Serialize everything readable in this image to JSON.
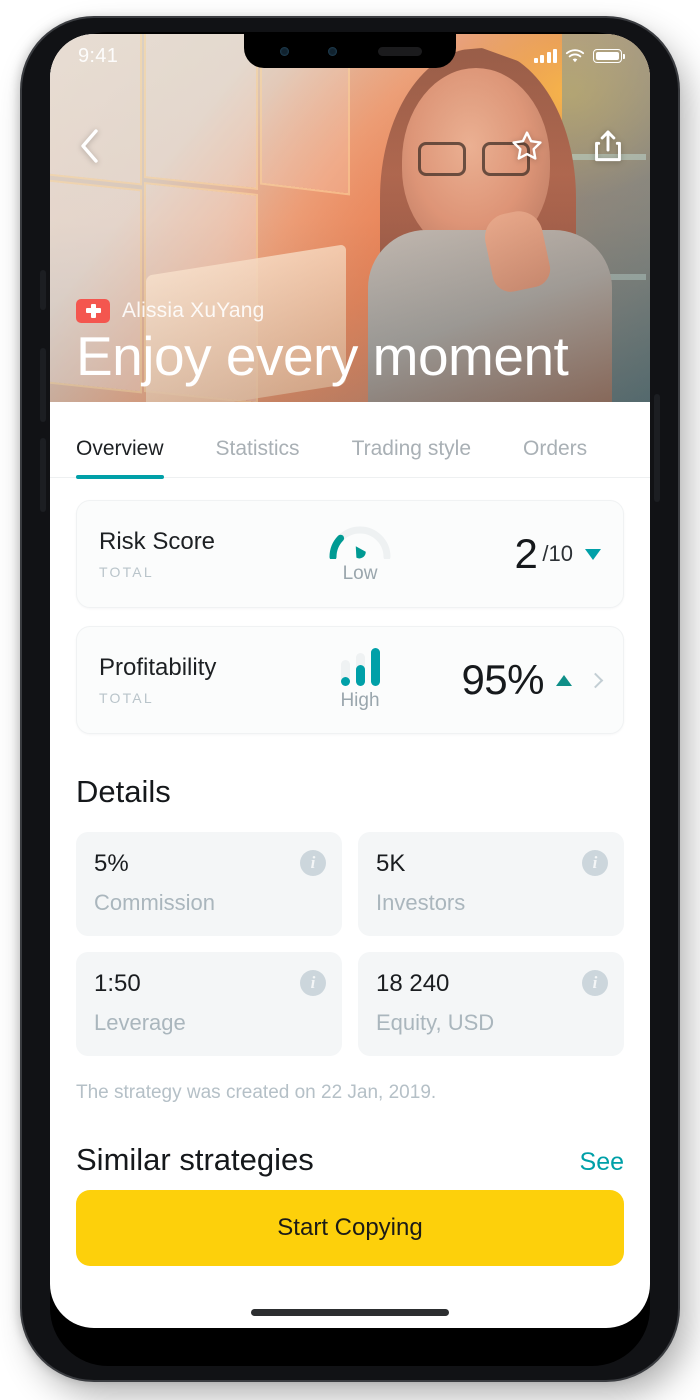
{
  "status_bar": {
    "time": "9:41",
    "signal_icon": "cellular-bars-icon",
    "wifi_icon": "wifi-icon",
    "battery_icon": "battery-full-icon"
  },
  "hero": {
    "back_icon": "chevron-left-icon",
    "favorite_icon": "star-outline-icon",
    "share_icon": "share-upload-icon",
    "flag_icon": "swiss-flag-icon",
    "trader_name": "Alissia XuYang",
    "title": "Enjoy every moment"
  },
  "tabs": [
    {
      "label": "Overview",
      "active": true
    },
    {
      "label": "Statistics",
      "active": false
    },
    {
      "label": "Trading style",
      "active": false
    },
    {
      "label": "Orders",
      "active": false
    }
  ],
  "metrics": [
    {
      "title": "Risk Score",
      "total_label": "TOTAL",
      "level": "Low",
      "value": "2",
      "suffix": "/10",
      "trend": "down",
      "indicator_icon": "gauge-icon"
    },
    {
      "title": "Profitability",
      "total_label": "TOTAL",
      "level": "High",
      "value": "95%",
      "suffix": "",
      "trend": "up",
      "indicator_icon": "bar-levels-icon"
    }
  ],
  "details": {
    "heading": "Details",
    "tiles": [
      {
        "value": "5%",
        "label": "Commission",
        "info_icon": "info-icon"
      },
      {
        "value": "5K",
        "label": "Investors",
        "info_icon": "info-icon"
      },
      {
        "value": "1:50",
        "label": "Leverage",
        "info_icon": "info-icon"
      },
      {
        "value": "18 240",
        "label": "Equity, USD",
        "info_icon": "info-icon"
      }
    ],
    "created_note": "The strategy was created on 22 Jan, 2019."
  },
  "similar": {
    "heading": "Similar strategies",
    "see_link": "See"
  },
  "cta": {
    "label": "Start Copying"
  },
  "colors": {
    "accent_teal": "#00a0a8",
    "cta_yellow": "#fdd00b",
    "flag_red": "#f4564f",
    "muted_text": "#aab6bd"
  }
}
